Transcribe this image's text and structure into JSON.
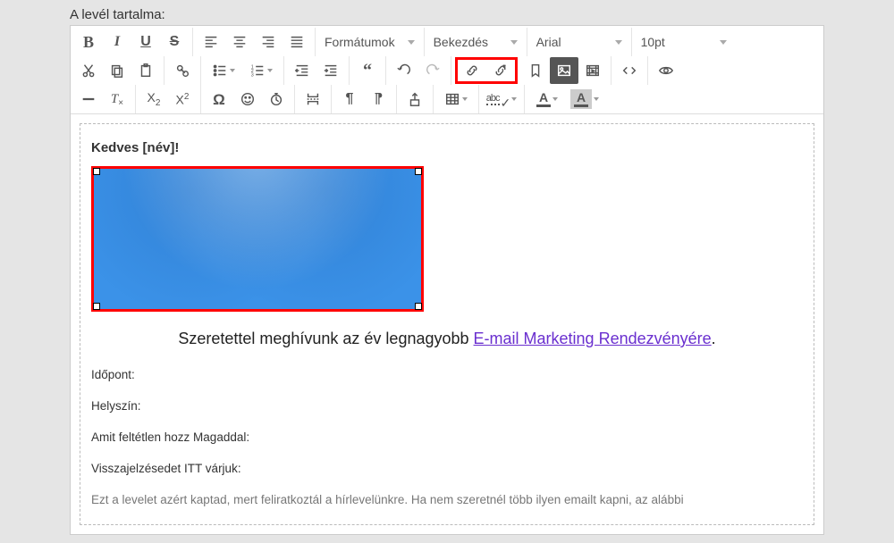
{
  "label": "A levél tartalma:",
  "toolbar": {
    "formats": "Formátumok",
    "paragraph": "Bekezdés",
    "font": "Arial",
    "size": "10pt"
  },
  "content": {
    "greeting": "Kedves [név]!",
    "invite_pre": "Szeretettel meghívunk az év legnagyobb ",
    "invite_link": "E-mail Marketing Rendezvényére",
    "invite_post": ".",
    "time": "Időpont:",
    "place": "Helyszín:",
    "bring": "Amit feltétlen hozz Magaddal:",
    "feedback": "Visszajelzésedet ITT várjuk:",
    "footer": "Ezt a levelet azért kaptad, mert feliratkoztál a hírlevelünkre. Ha nem szeretnél több ilyen emailt kapni, az alábbi"
  }
}
